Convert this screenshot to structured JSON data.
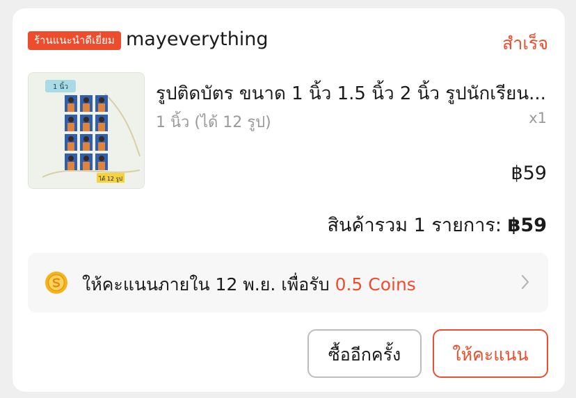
{
  "shop": {
    "badge": "ร้านแนะนำดีเยี่ยม",
    "name": "mayeverything",
    "status": "สำเร็จ"
  },
  "product": {
    "title": "รูปติดบัตร ขนาด 1 นิ้ว 1.5 นิ้ว 2 นิ้ว รูปนักเรียน...",
    "variant": "1 นิ้ว (ได้ 12 รูป)",
    "quantity": "x1",
    "price": "฿59",
    "thumb_tag": "1 นิ้ว",
    "thumb_count": "ได้ 12 รูป"
  },
  "summary": {
    "label": "สินค้ารวม 1 รายการ:",
    "amount": "฿59"
  },
  "rating": {
    "text": "ให้คะแนนภายใน 12 พ.ย. เพื่อรับ",
    "coins": "0.5 Coins"
  },
  "actions": {
    "buy_again": "ซื้ออีกครั้ง",
    "rate": "ให้คะแนน"
  },
  "colors": {
    "accent": "#ee4d2d",
    "coin": "#f5b31a"
  }
}
